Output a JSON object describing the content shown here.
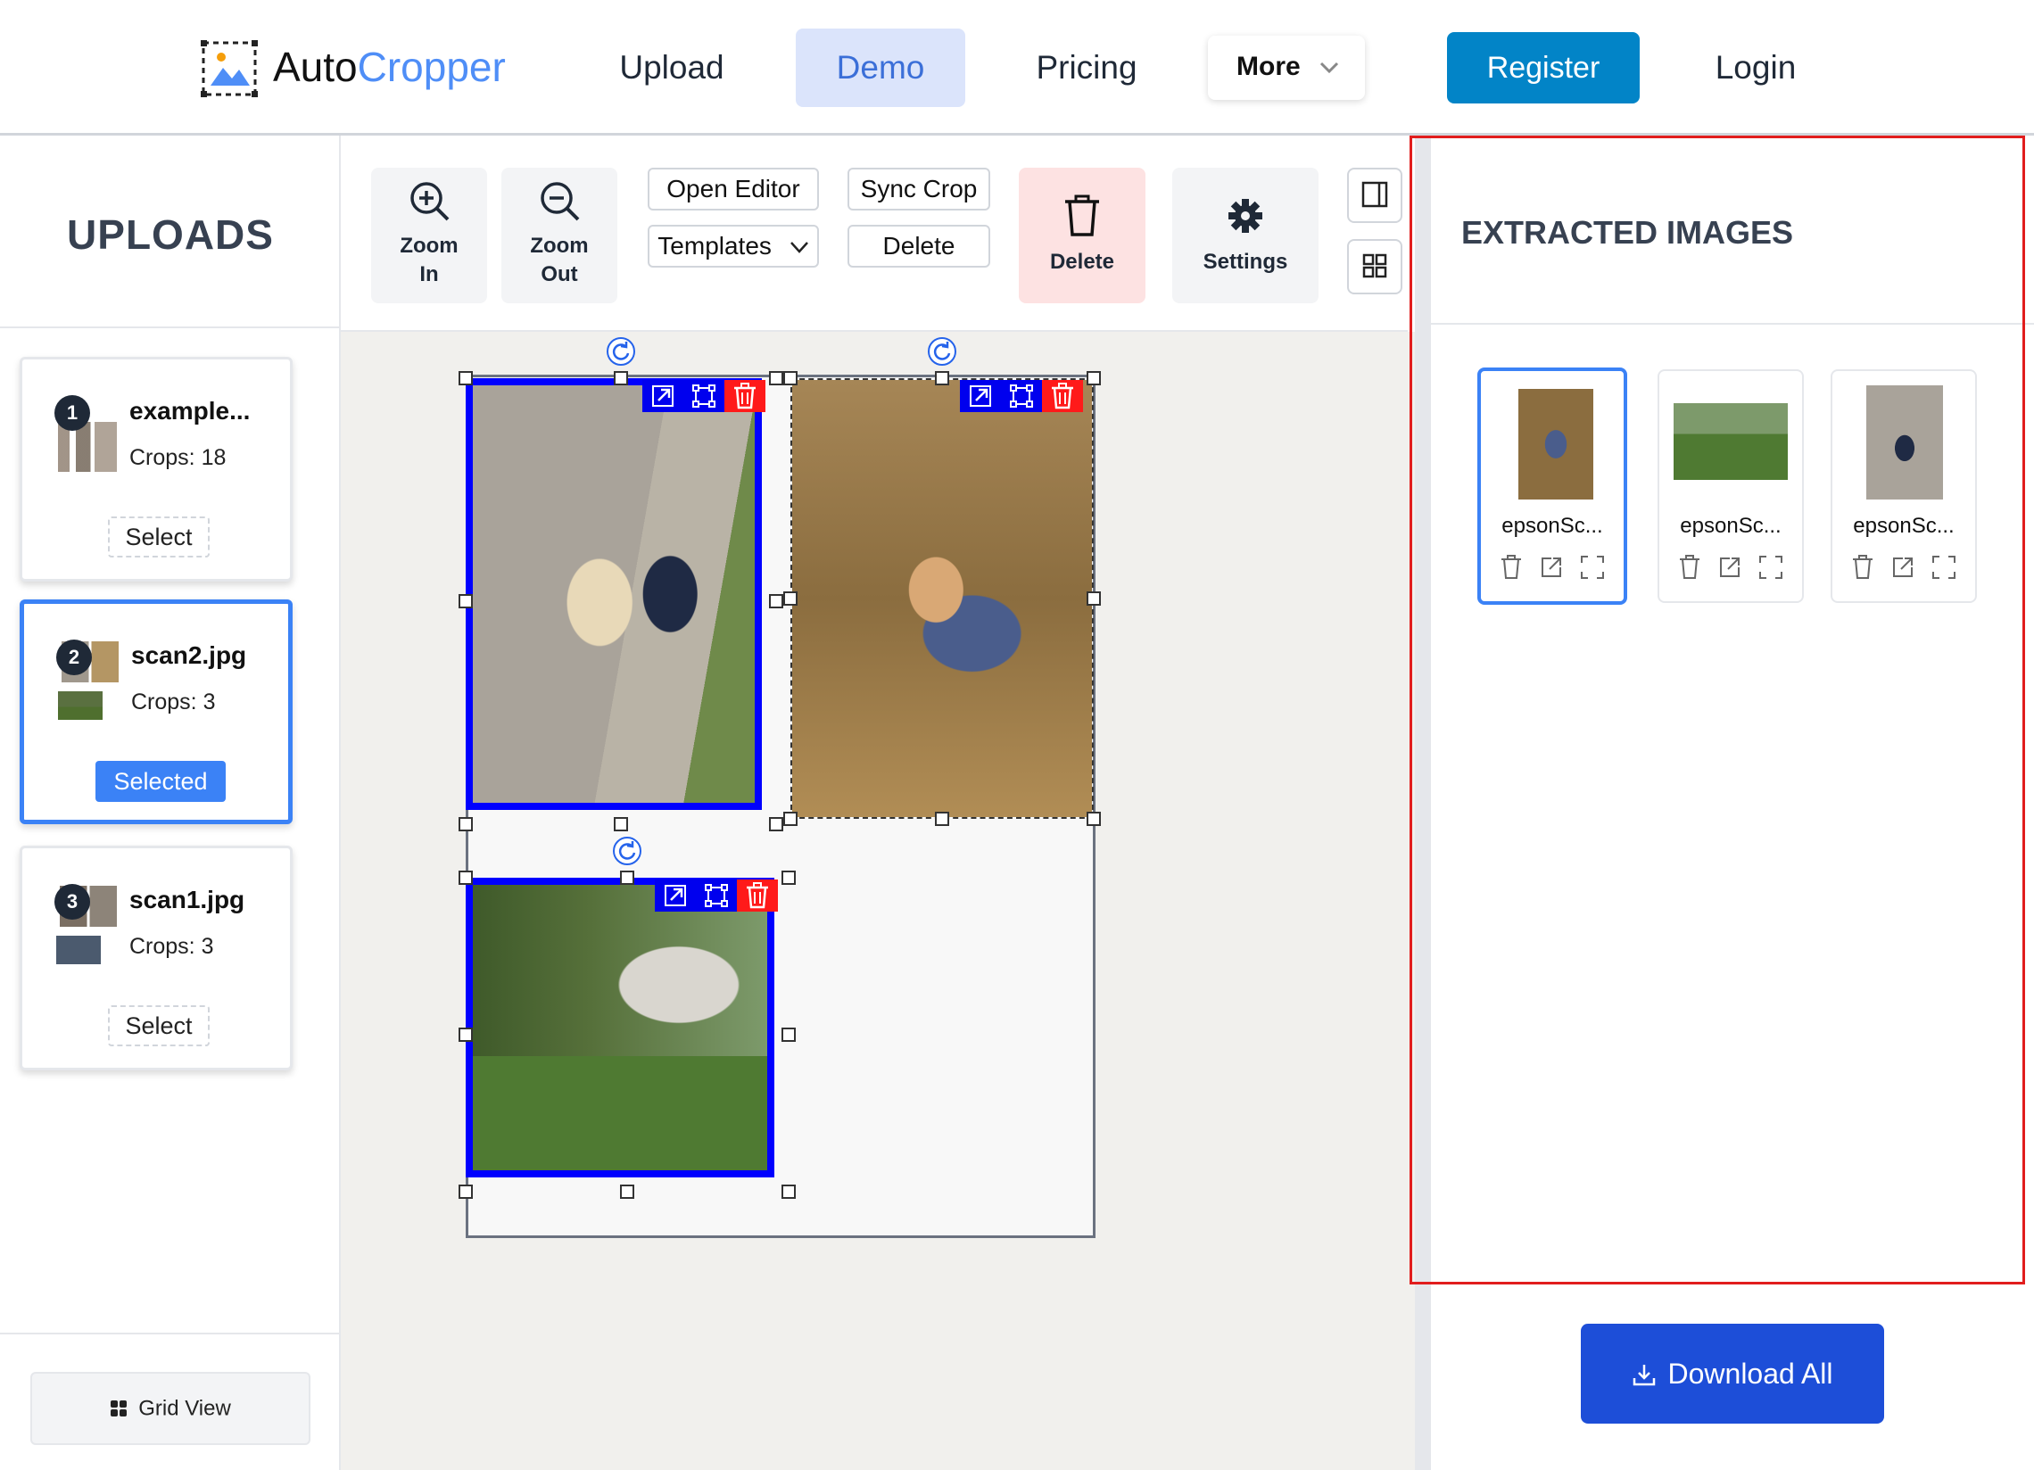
{
  "app": {
    "brand_auto": "Auto",
    "brand_cropper": "Cropper",
    "brand_color": "#4f8ef7"
  },
  "nav": {
    "upload": "Upload",
    "demo": "Demo",
    "pricing": "Pricing",
    "more": "More",
    "register": "Register",
    "login": "Login"
  },
  "sidebar": {
    "title": "UPLOADS",
    "items": [
      {
        "badge": "1",
        "name": "example...",
        "crops": "Crops: 18",
        "button": "Select"
      },
      {
        "badge": "2",
        "name": "scan2.jpg",
        "crops": "Crops: 3",
        "button": "Selected"
      },
      {
        "badge": "3",
        "name": "scan1.jpg",
        "crops": "Crops: 3",
        "button": "Select"
      }
    ],
    "grid_view": "Grid View"
  },
  "toolbar": {
    "zoom_in_1": "Zoom",
    "zoom_in_2": "In",
    "zoom_out_1": "Zoom",
    "zoom_out_2": "Out",
    "open_editor": "Open Editor",
    "templates": "Templates",
    "sync_crop": "Sync Crop",
    "delete_small": "Delete",
    "delete": "Delete",
    "settings": "Settings"
  },
  "extracted": {
    "title": "EXTRACTED IMAGES",
    "items": [
      {
        "name": "epsonSc..."
      },
      {
        "name": "epsonSc..."
      },
      {
        "name": "epsonSc..."
      }
    ],
    "download_all": "Download All"
  },
  "colors": {
    "accent": "#0284c7",
    "selection": "#3b82f6",
    "crop_border": "#0000ff",
    "danger": "#ff1a1a",
    "download": "#1d4ed8",
    "highlight_box": "#e11d1d"
  }
}
